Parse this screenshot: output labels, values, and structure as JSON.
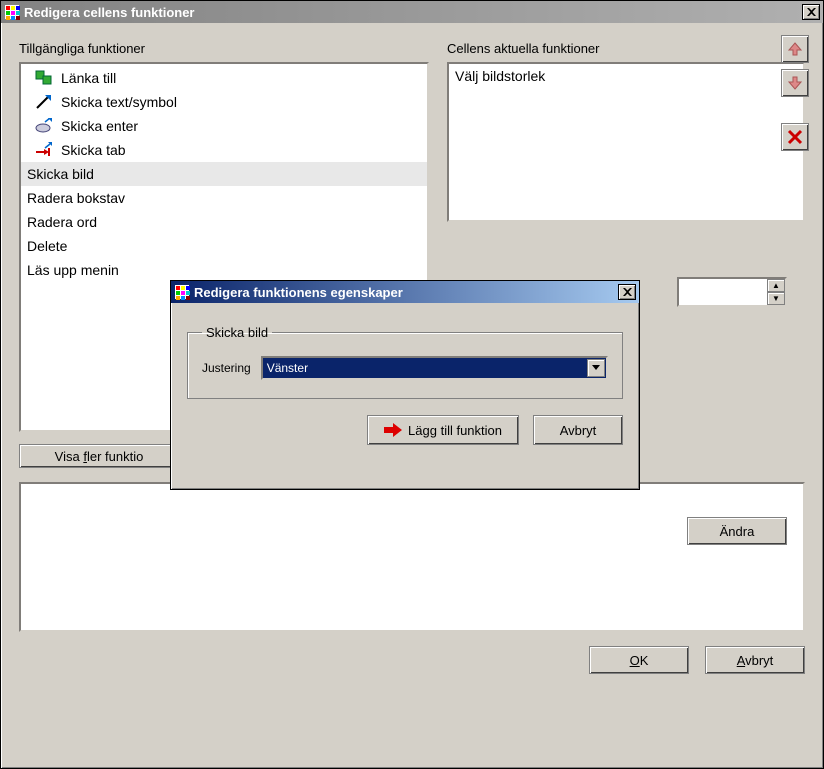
{
  "main": {
    "title": "Redigera cellens funktioner",
    "left_label": "Tillgängliga funktioner",
    "right_label": "Cellens aktuella funktioner",
    "available": [
      {
        "label": "Länka till",
        "icon": "link"
      },
      {
        "label": "Skicka text/symbol",
        "icon": "arrow"
      },
      {
        "label": "Skicka enter",
        "icon": "enter"
      },
      {
        "label": "Skicka tab",
        "icon": "tab"
      },
      {
        "label": "Skicka bild",
        "icon": "",
        "selected": true
      },
      {
        "label": "Radera bokstav",
        "icon": ""
      },
      {
        "label": "Radera ord",
        "icon": ""
      },
      {
        "label": "Delete",
        "icon": ""
      },
      {
        "label": "Läs upp menin",
        "icon": ""
      }
    ],
    "current": [
      {
        "label": "Välj bildstorlek"
      }
    ],
    "show_more": "Visa fler funktio",
    "change": "Ändra",
    "ok": "OK",
    "cancel": "Avbryt"
  },
  "modal": {
    "title": "Redigera funktionens egenskaper",
    "group": "Skicka bild",
    "field_label": "Justering",
    "field_value": "Vänster",
    "add": "Lägg till funktion",
    "cancel": "Avbryt"
  }
}
